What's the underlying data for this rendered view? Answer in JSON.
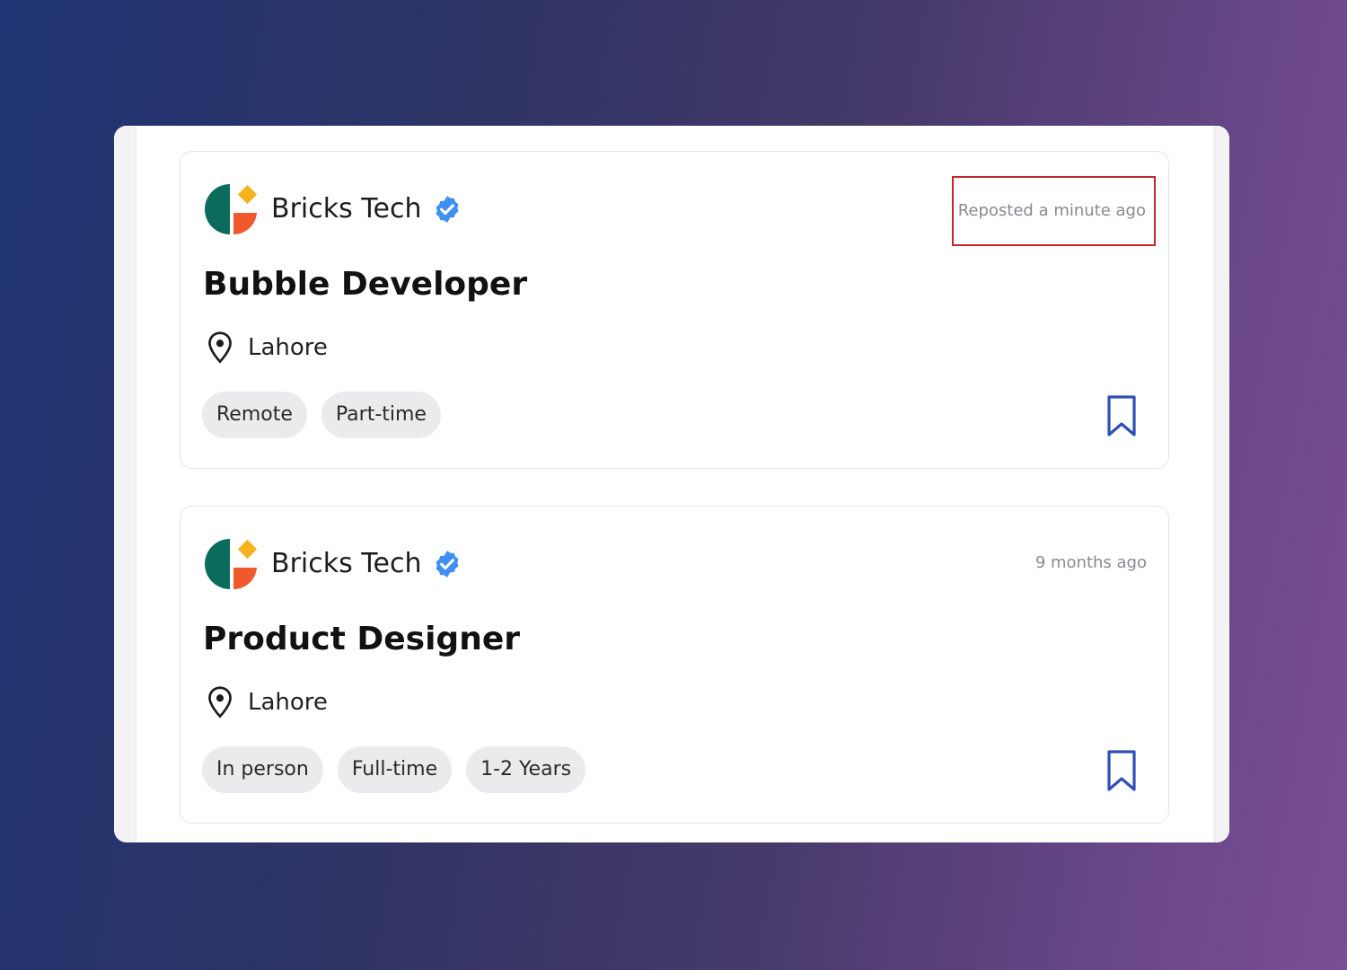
{
  "jobs": [
    {
      "company": "Bricks Tech",
      "posted": "Reposted a minute ago",
      "title": "Bubble Developer",
      "location": "Lahore",
      "tags": [
        "Remote",
        "Part-time"
      ]
    },
    {
      "company": "Bricks Tech",
      "posted": "9 months ago",
      "title": "Product Designer",
      "location": "Lahore",
      "tags": [
        "In person",
        "Full-time",
        "1-2 Years"
      ]
    }
  ],
  "icons": {
    "logo": "bricks-tech-logo",
    "verified": "verified-badge-icon",
    "location": "map-pin-icon",
    "save": "bookmark-icon"
  },
  "colors": {
    "logo_teal": "#0b6b5c",
    "logo_orange": "#f0592b",
    "logo_yellow": "#f7b21d",
    "verified_blue": "#3f8ff2",
    "bookmark_blue": "#2f4fb8",
    "highlight_red": "#c0282d"
  }
}
